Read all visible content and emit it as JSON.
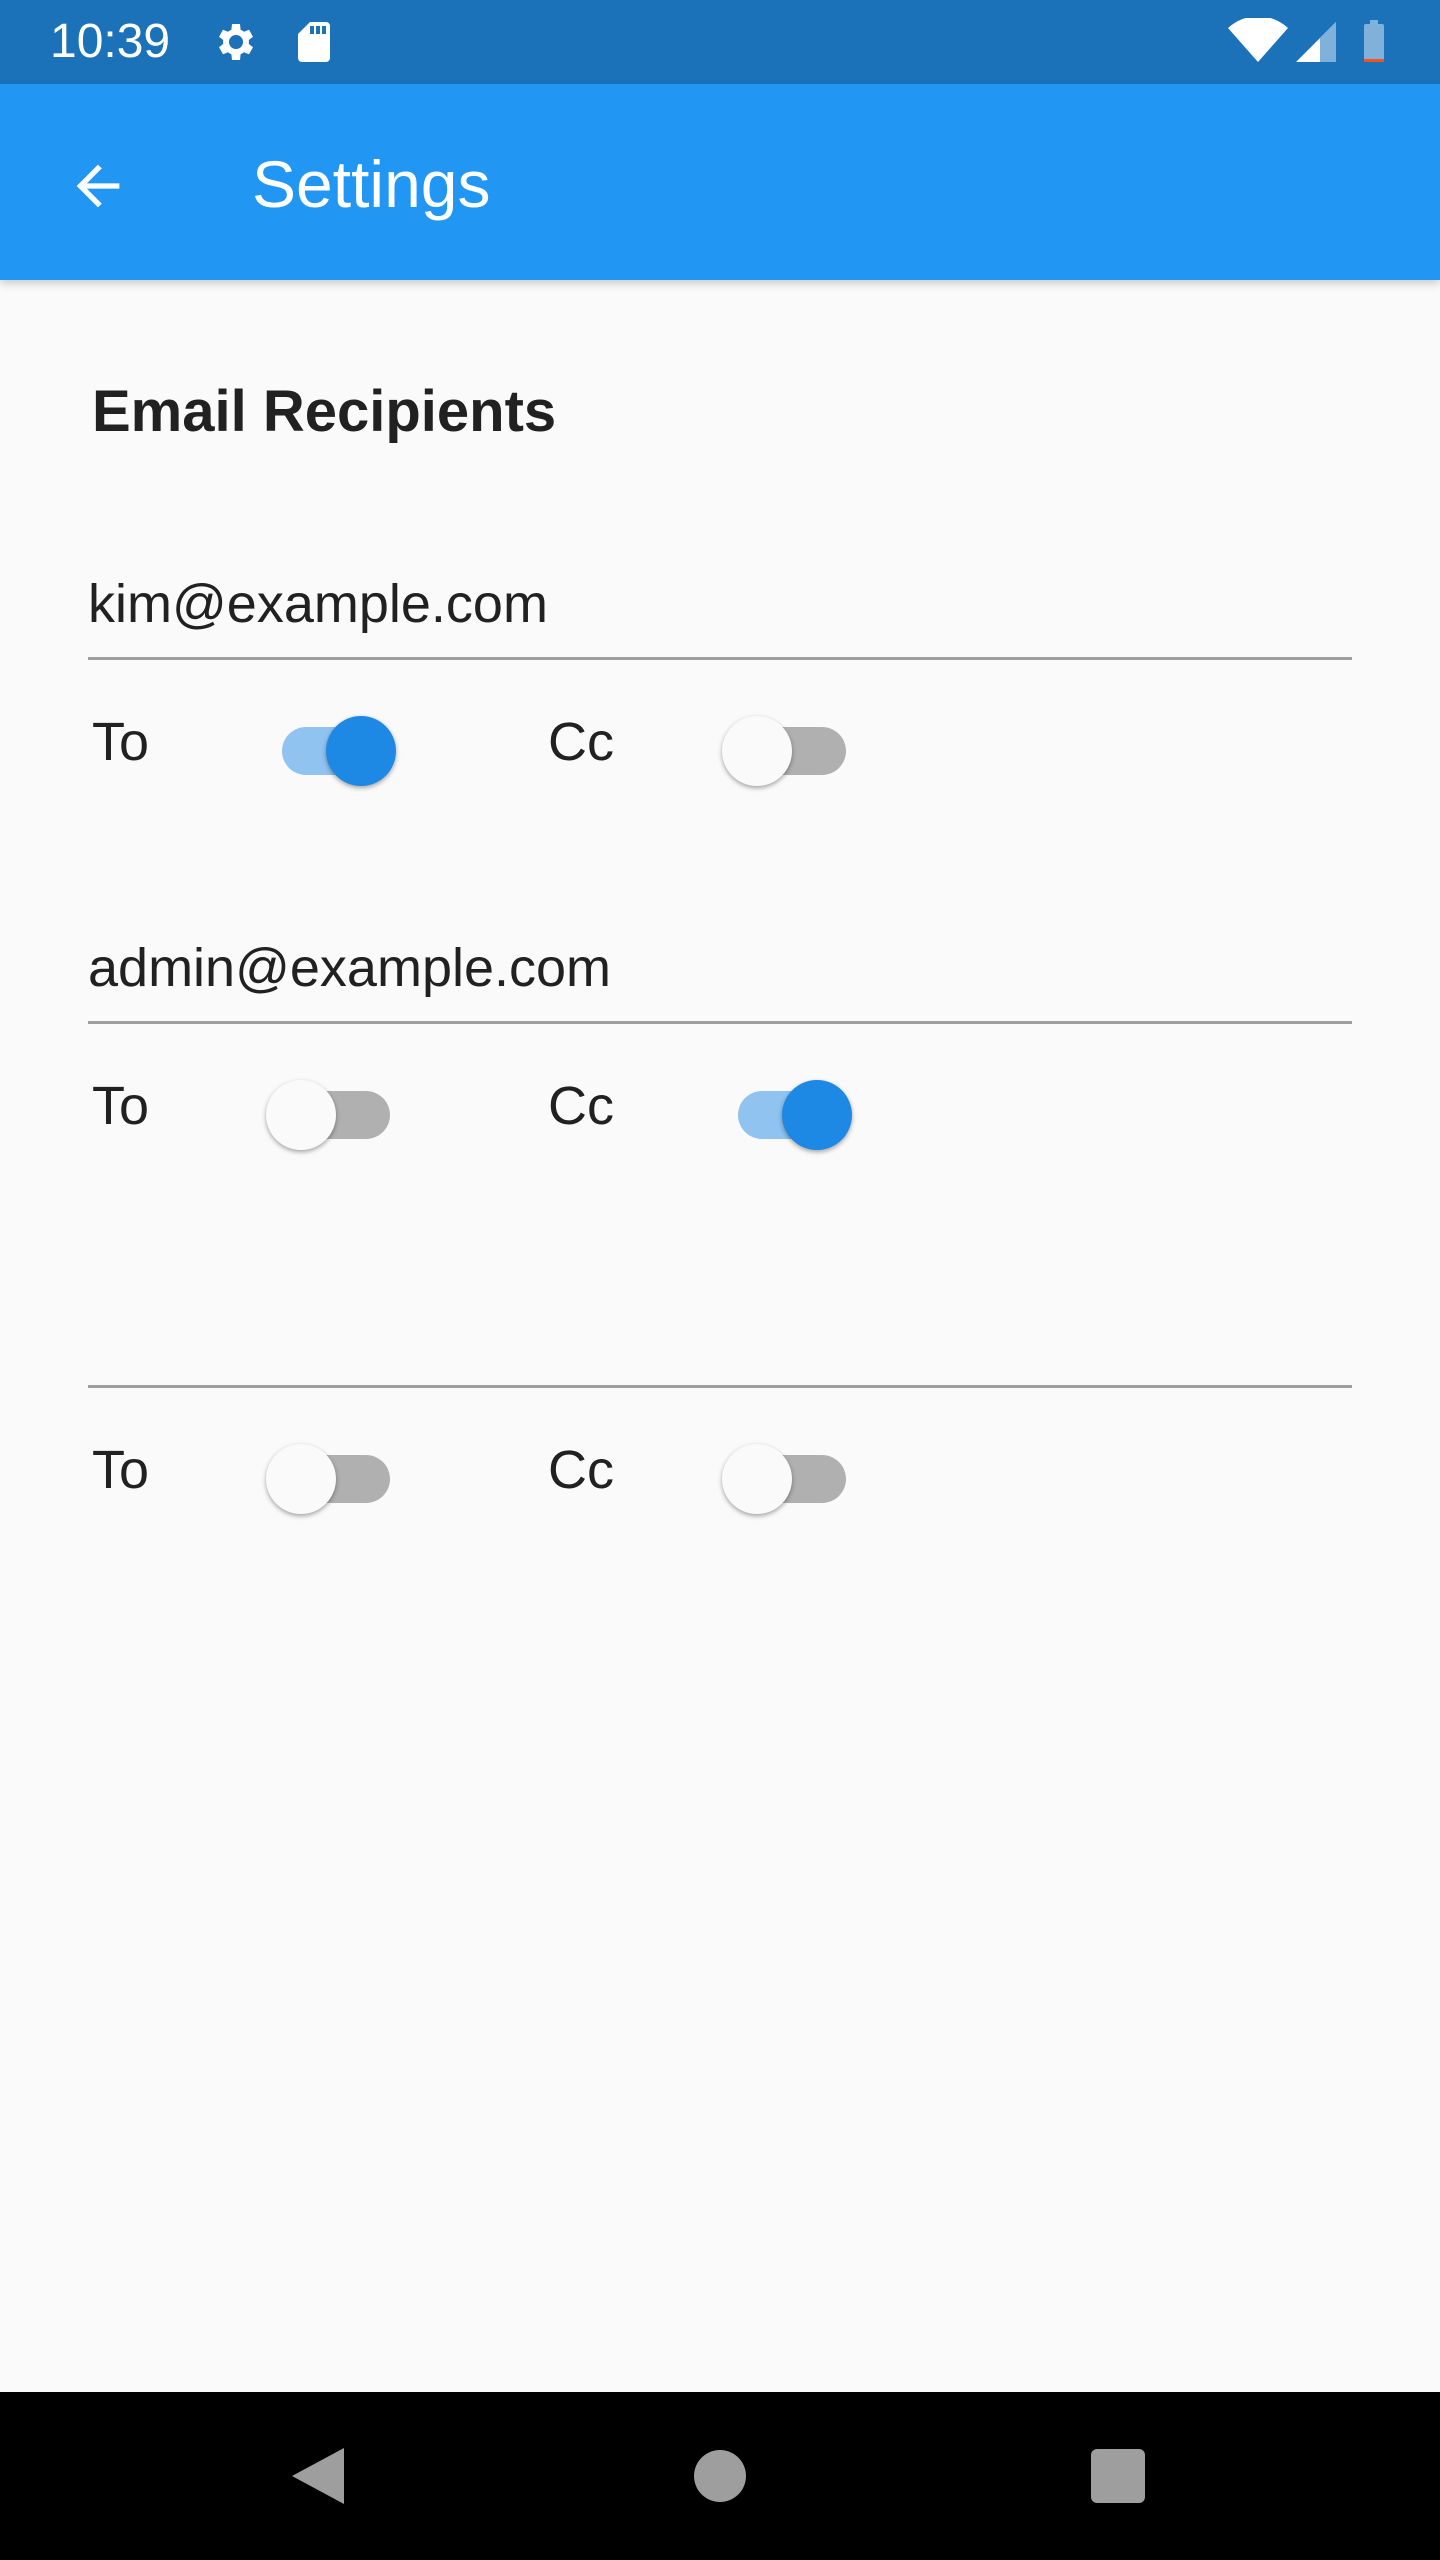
{
  "status_bar": {
    "time": "10:39",
    "icons": [
      "gear-icon",
      "sd-card-icon",
      "wifi-icon",
      "cell-signal-icon",
      "battery-icon"
    ]
  },
  "app_bar": {
    "title": "Settings",
    "back_icon": "arrow-back-icon"
  },
  "section": {
    "title": "Email Recipients"
  },
  "recipients": [
    {
      "email": "kim@example.com",
      "to_label": "To",
      "to_on": true,
      "cc_label": "Cc",
      "cc_on": false
    },
    {
      "email": "admin@example.com",
      "to_label": "To",
      "to_on": false,
      "cc_label": "Cc",
      "cc_on": true
    },
    {
      "email": "",
      "to_label": "To",
      "to_on": false,
      "cc_label": "Cc",
      "cc_on": false
    }
  ],
  "nav_bar": {
    "icons": [
      "back-triangle-icon",
      "home-circle-icon",
      "recents-square-icon"
    ]
  },
  "colors": {
    "status_bar": "#1B72B9",
    "app_bar": "#2196F3",
    "switch_on_thumb": "#1E88E5",
    "switch_on_track": "#90C3F0",
    "switch_off_track": "#B0B0B0"
  }
}
